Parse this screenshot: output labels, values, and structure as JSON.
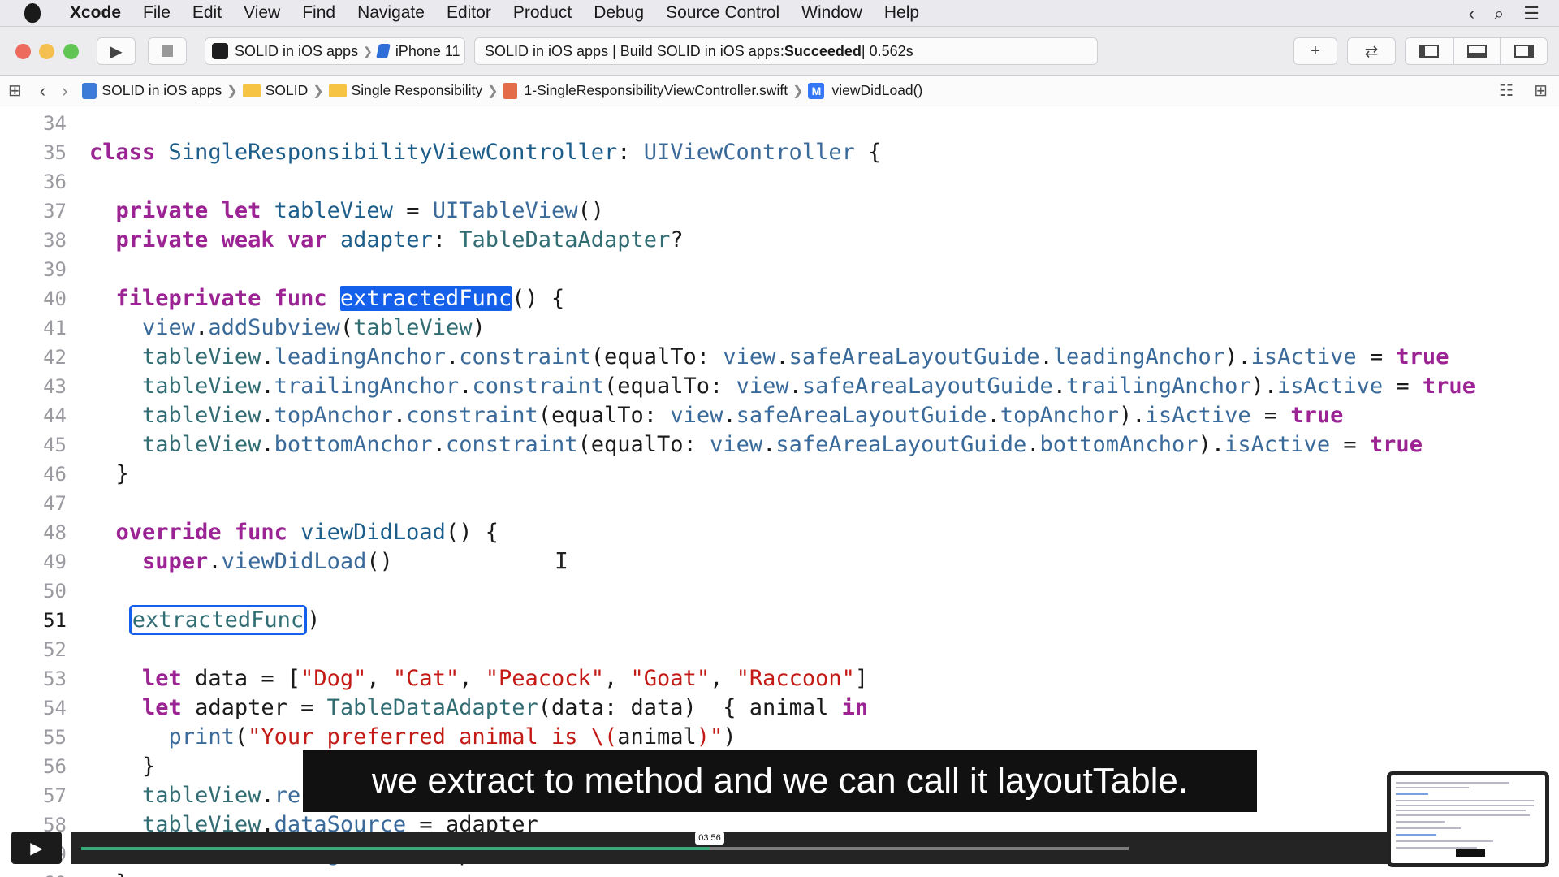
{
  "menubar": {
    "items": [
      "Xcode",
      "File",
      "Edit",
      "View",
      "Find",
      "Navigate",
      "Editor",
      "Product",
      "Debug",
      "Source Control",
      "Window",
      "Help"
    ],
    "right_icons": [
      "chevron-left-icon",
      "search-icon",
      "list-icon"
    ]
  },
  "toolbar": {
    "scheme_app": "SOLID in iOS apps",
    "scheme_sep": "❯",
    "scheme_device": "iPhone 11",
    "activity_prefix": "SOLID in iOS apps | Build SOLID in iOS apps: ",
    "activity_status": "Succeeded",
    "activity_time": " | 0.562s"
  },
  "jumpbar": {
    "crumbs": [
      "SOLID in iOS apps",
      "SOLID",
      "Single Responsibility",
      "1-SingleResponsibilityViewController.swift",
      "viewDidLoad()"
    ],
    "method_badge": "M"
  },
  "editor": {
    "lines": [
      {
        "n": "34",
        "html": ""
      },
      {
        "n": "35",
        "html": "<span class=\"kw\">class</span> <span class=\"ty\">SingleResponsibilityViewController</span>: <span class=\"sy\">UIViewController</span> {"
      },
      {
        "n": "36",
        "html": ""
      },
      {
        "n": "37",
        "html": "  <span class=\"kw\">private</span> <span class=\"kw\">let</span> <span class=\"ty\">tableView</span> = <span class=\"sy\">UITableView</span>()"
      },
      {
        "n": "38",
        "html": "  <span class=\"kw\">private</span> <span class=\"kw\">weak</span> <span class=\"kw\">var</span> <span class=\"ty\">adapter</span>: <span class=\"fn\">TableDataAdapter</span>?"
      },
      {
        "n": "39",
        "html": ""
      },
      {
        "n": "40",
        "html": "  <span class=\"kw\">fileprivate</span> <span class=\"kw\">func</span> <span class=\"sel\">extractedFunc</span>() {"
      },
      {
        "n": "41",
        "html": "    <span class=\"sy\">view</span>.<span class=\"sy\">addSubview</span>(<span class=\"fn\">tableView</span>)"
      },
      {
        "n": "42",
        "html": "    <span class=\"fn\">tableView</span>.<span class=\"sy\">leadingAnchor</span>.<span class=\"sy\">constraint</span>(equalTo: <span class=\"sy\">view</span>.<span class=\"sy\">safeAreaLayoutGuide</span>.<span class=\"sy\">leadingAnchor</span>).<span class=\"sy\">isActive</span> = <span class=\"kw\">true</span>"
      },
      {
        "n": "43",
        "html": "    <span class=\"fn\">tableView</span>.<span class=\"sy\">trailingAnchor</span>.<span class=\"sy\">constraint</span>(equalTo: <span class=\"sy\">view</span>.<span class=\"sy\">safeAreaLayoutGuide</span>.<span class=\"sy\">trailingAnchor</span>).<span class=\"sy\">isActive</span> = <span class=\"kw\">true</span>"
      },
      {
        "n": "44",
        "html": "    <span class=\"fn\">tableView</span>.<span class=\"sy\">topAnchor</span>.<span class=\"sy\">constraint</span>(equalTo: <span class=\"sy\">view</span>.<span class=\"sy\">safeAreaLayoutGuide</span>.<span class=\"sy\">topAnchor</span>).<span class=\"sy\">isActive</span> = <span class=\"kw\">true</span>"
      },
      {
        "n": "45",
        "html": "    <span class=\"fn\">tableView</span>.<span class=\"sy\">bottomAnchor</span>.<span class=\"sy\">constraint</span>(equalTo: <span class=\"sy\">view</span>.<span class=\"sy\">safeAreaLayoutGuide</span>.<span class=\"sy\">bottomAnchor</span>).<span class=\"sy\">isActive</span> = <span class=\"kw\">true</span>"
      },
      {
        "n": "46",
        "html": "  }"
      },
      {
        "n": "47",
        "html": ""
      },
      {
        "n": "48",
        "html": "  <span class=\"kw\">override</span> <span class=\"kw\">func</span> <span class=\"ty\">viewDidLoad</span>() {"
      },
      {
        "n": "49",
        "html": "    <span class=\"kw\">super</span>.<span class=\"sy\">viewDidLoad</span>()"
      },
      {
        "n": "50",
        "html": ""
      },
      {
        "n": "51",
        "html": "   <span class=\"ring\"><span class=\"fn\">extractedFunc</span></span>)"
      },
      {
        "n": "52",
        "html": ""
      },
      {
        "n": "53",
        "html": "    <span class=\"kw\">let</span> data = [<span class=\"str\">\"Dog\"</span>, <span class=\"str\">\"Cat\"</span>, <span class=\"str\">\"Peacock\"</span>, <span class=\"str\">\"Goat\"</span>, <span class=\"str\">\"Raccoon\"</span>]"
      },
      {
        "n": "54",
        "html": "    <span class=\"kw\">let</span> adapter = <span class=\"fn\">TableDataAdapter</span>(data: data)  { animal <span class=\"kw\">in</span>"
      },
      {
        "n": "55",
        "html": "      <span class=\"sy\">print</span>(<span class=\"str\">\"Your preferred animal is \\(</span>animal<span class=\"str\">)\"</span>)"
      },
      {
        "n": "56",
        "html": "    }"
      },
      {
        "n": "57",
        "html": "    <span class=\"fn\">tableView</span>.<span class=\"sy\">re</span>"
      },
      {
        "n": "58",
        "html": "    <span class=\"fn\">tableView</span>.<span class=\"sy\">dataSource</span> = adapter"
      },
      {
        "n": "59",
        "html": "    <span class=\"fn\">tableView</span>.<span class=\"sy\">delegate</span> = adapter"
      },
      {
        "n": "60",
        "html": "  }"
      }
    ],
    "current_line": "51",
    "cursor_glyph": "I"
  },
  "video": {
    "subtitle": "we extract to method and we can call it layoutTable.",
    "time": "03:56",
    "progress_fraction": 0.6
  },
  "colors": {
    "accent": "#1460ea",
    "keyword": "#9b2393",
    "string": "#c41a16",
    "progress": "#3aa877"
  }
}
